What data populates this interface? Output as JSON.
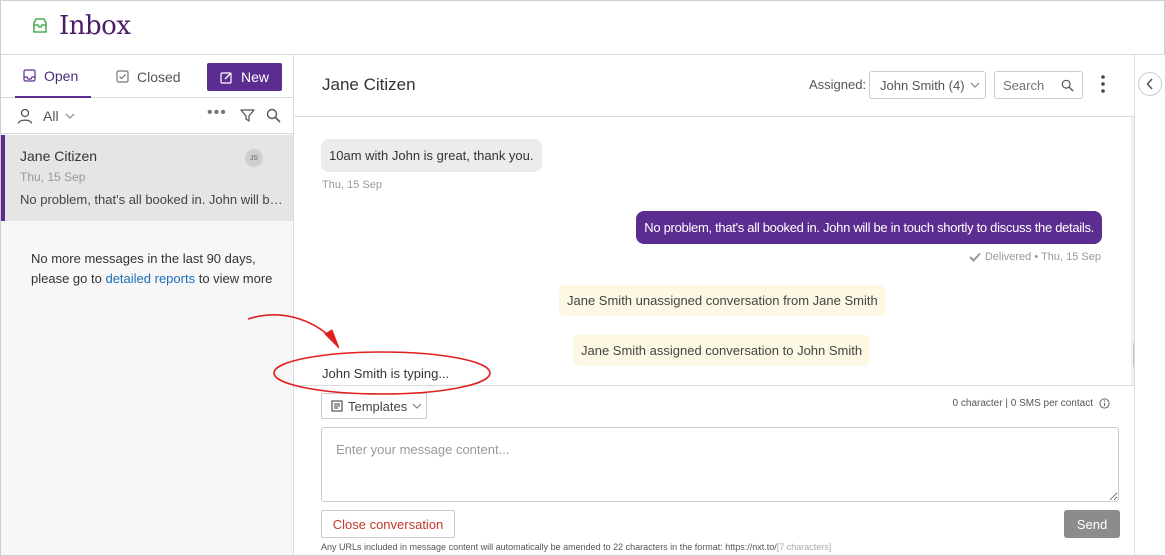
{
  "header": {
    "title": "Inbox",
    "icon": "inbox-icon"
  },
  "sidebar": {
    "tabs": [
      {
        "label": "Open",
        "icon": "inbox-tray-icon"
      },
      {
        "label": "Closed",
        "icon": "check-box-icon"
      }
    ],
    "new_label": "New",
    "filter": {
      "selected": "All"
    },
    "conversation": {
      "name": "Jane Citizen",
      "date": "Thu, 15 Sep",
      "preview": "No problem, that's all booked in. John will b…",
      "avatar": "JS"
    },
    "no_more": {
      "line1": "No more messages in the last 90 days,",
      "prefix": "please go to",
      "link": "detailed reports",
      "suffix": "to view more"
    }
  },
  "main": {
    "contact_name": "Jane Citizen",
    "assigned_label": "Assigned:",
    "assigned_value": "John Smith (4)",
    "search_placeholder": "Search"
  },
  "messages": {
    "incoming": {
      "text": "10am with John is great, thank you.",
      "meta": "Thu, 15 Sep"
    },
    "outgoing": {
      "text": "No problem, that's all booked in. John will be in touch shortly to discuss the details.",
      "meta": "Delivered • Thu, 15 Sep"
    },
    "system": [
      "Jane Smith unassigned conversation from Jane Smith",
      "Jane Smith assigned conversation to John Smith"
    ],
    "typing": "John Smith is typing..."
  },
  "composer": {
    "templates_label": "Templates",
    "char_count": "0 character | 0 SMS per contact",
    "placeholder": "Enter your message content...",
    "close_label": "Close conversation",
    "send_label": "Send",
    "url_note": "Any URLs included in message content will automatically be amended to 22 characters in the format: https://nxt.to/",
    "url_note_suffix": "[7 characters]"
  },
  "colors": {
    "brand": "#5c2d91",
    "annotation": "#e02020",
    "green_icon": "#4caf50"
  }
}
